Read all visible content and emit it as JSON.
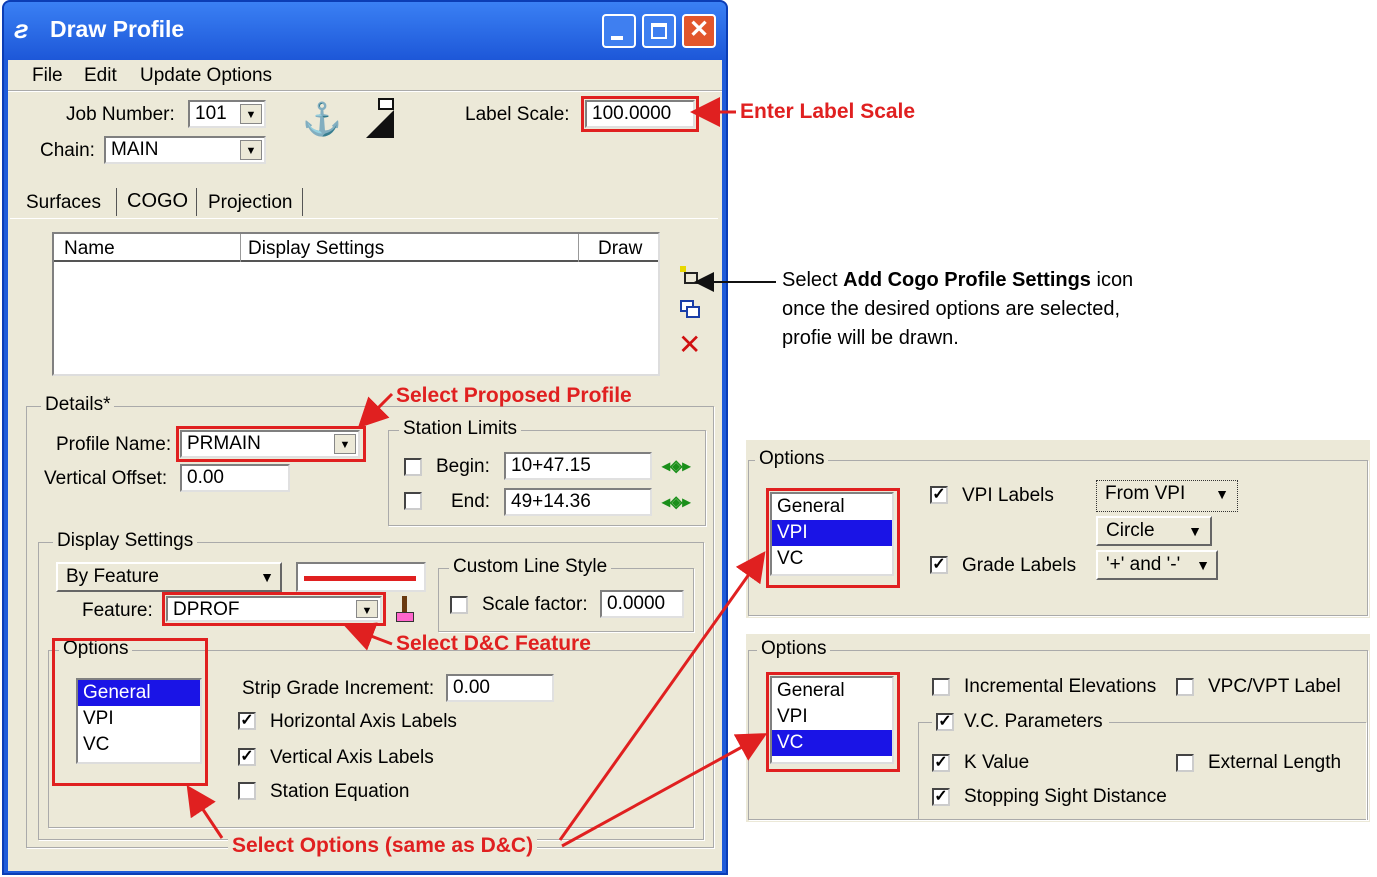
{
  "window": {
    "title": "Draw Profile"
  },
  "menu": {
    "file": "File",
    "edit": "Edit",
    "update_options": "Update Options"
  },
  "job": {
    "label": "Job Number:",
    "value": "101"
  },
  "chain": {
    "label": "Chain:",
    "value": "MAIN"
  },
  "label_scale": {
    "label": "Label Scale:",
    "value": "100.0000"
  },
  "tabs": [
    "Surfaces",
    "COGO",
    "Projection"
  ],
  "table": {
    "columns": [
      "Name",
      "Display Settings",
      "Draw"
    ]
  },
  "details": {
    "label": "Details*",
    "profile_name_label": "Profile Name:",
    "profile_name": "PRMAIN",
    "vertical_offset_label": "Vertical Offset:",
    "vertical_offset": "0.00"
  },
  "station_limits": {
    "label": "Station Limits",
    "begin_label": "Begin:",
    "begin": "10+47.15",
    "end_label": "End:",
    "end": "49+14.36"
  },
  "display_settings": {
    "label": "Display Settings",
    "mode": "By Feature",
    "feature_label": "Feature:",
    "feature": "DPROF",
    "line_color": "#e02020"
  },
  "custom_line_style": {
    "label": "Custom Line Style",
    "scale_label": "Scale factor:",
    "scale": "0.0000"
  },
  "options": {
    "label": "Options",
    "items": [
      "General",
      "VPI",
      "VC"
    ],
    "strip_grade_label": "Strip Grade Increment:",
    "strip_grade": "0.00",
    "horizontal_axis": "Horizontal Axis Labels",
    "vertical_axis": "Vertical Axis Labels",
    "station_equation": "Station Equation"
  },
  "annotations": {
    "label_scale": "Enter Label Scale",
    "proposed_profile": "Select Proposed Profile",
    "dc_feature": "Select D&C Feature",
    "options": "Select Options (same as D&C)",
    "cogo_prefix": "Select ",
    "cogo_bold": "Add Cogo Profile Settings",
    "cogo_suffix": " icon",
    "cogo_line2": "once the desired options are selected,",
    "cogo_line3": "profie will be drawn."
  },
  "vpi_panel": {
    "label": "Options",
    "items": [
      "General",
      "VPI",
      "VC"
    ],
    "vpi_labels": "VPI Labels",
    "vpi_from": "From VPI",
    "vpi_shape": "Circle",
    "grade_labels": "Grade Labels",
    "grade_format": "'+' and '-'"
  },
  "vc_panel": {
    "label": "Options",
    "items": [
      "General",
      "VPI",
      "VC"
    ],
    "incremental": "Incremental Elevations",
    "vpc_label": "VPC/VPT Label",
    "vc_params": "V.C. Parameters",
    "k_value": "K Value",
    "external_length": "External Length",
    "stopping": "Stopping Sight Distance"
  }
}
